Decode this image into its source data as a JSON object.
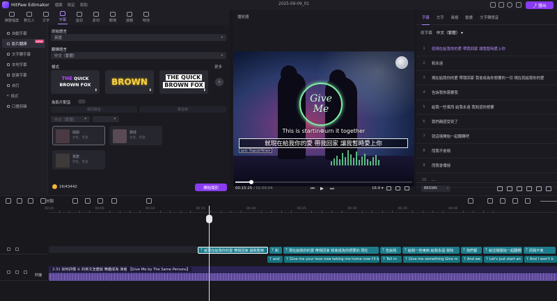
{
  "app": {
    "name": "HitPaw Edimakor",
    "menus": [
      "檔案",
      "設定",
      "幫助"
    ],
    "document_title": "2025-09-09_01",
    "export_label": "匯出"
  },
  "toolbar": {
    "items": [
      {
        "label": "媒體檔案"
      },
      {
        "label": "數位人"
      },
      {
        "label": "文字"
      },
      {
        "label": "字幕"
      },
      {
        "label": "音訊"
      },
      {
        "label": "素材"
      },
      {
        "label": "轉場"
      },
      {
        "label": "濾鏡"
      },
      {
        "label": "特效"
      }
    ],
    "active_index": 3
  },
  "sidebar": {
    "items": [
      {
        "label": "自動字幕"
      },
      {
        "label": "影片翻譯",
        "badge": "NEW"
      },
      {
        "label": "文字轉字幕"
      },
      {
        "label": "本地字幕"
      },
      {
        "label": "創建字幕"
      },
      {
        "label": "自訂"
      },
      {
        "label": "樣式"
      },
      {
        "label": "口播剪輯"
      }
    ],
    "active_index": 1
  },
  "settings": {
    "source_lang_label": "原始語言",
    "source_lang_value": "英語",
    "target_lang_label": "翻譯語言",
    "target_lang_value": "中文（繁體）",
    "style_label": "樣式",
    "more_label": "更多",
    "style_samples": [
      {
        "line1": "THE",
        "line1b": "QUICK",
        "line2": "BROWN FOX"
      },
      {
        "line1": "BROWN"
      },
      {
        "line1": "THE QUICK",
        "line2": "BROWN FOX"
      }
    ],
    "dub_label": "為影片配音",
    "voice_filter_1": "相同聲音",
    "voice_filter_2": "聲音庫",
    "lang_select": "中文（繁體）",
    "voices": [
      {
        "name": "娟娟",
        "tag": "女性，普通"
      },
      {
        "name": "蔣娃",
        "tag": "女性，普通"
      },
      {
        "name": "賈群",
        "tag": "男性，普通"
      }
    ],
    "credits_value": "16/43442",
    "start_button": "開始識別"
  },
  "player": {
    "title": "播放器",
    "overlay_text": "This is startin⊕urn it together",
    "givme_1": "Give",
    "givme_2": "Me",
    "subtitle_text": "就現在給我你的愛 帶我回家 讓我暫時愛上你",
    "credit_text": "Lyric: Tropical Phrase",
    "time_current": "00:15:25",
    "time_total": "/ 02:56:04",
    "ratio": "16:9",
    "progress_fraction": 0.09
  },
  "right_panel": {
    "tabs": [
      "字幕",
      "文字",
      "風格",
      "動畫",
      "文字轉語音"
    ],
    "active_tab": 0,
    "source_label": "原字幕",
    "lang_value": "中文（繁體）",
    "rows": [
      {
        "n": "1",
        "text": "就現在給我你的愛 帶我回家 讓我暫時愛上你"
      },
      {
        "n": "2",
        "text": "和永遠"
      },
      {
        "n": "3",
        "text": "現在給我你的愛 帶我回家 我會成為你想要的一切 現在就給我你的愛"
      },
      {
        "n": "4",
        "text": "告訴我你需要我"
      },
      {
        "n": "5",
        "text": "給我一些東西 給我永遠 我知道你想要"
      },
      {
        "n": "6",
        "text": "我們都感受到了"
      },
      {
        "n": "7",
        "text": "就這樣開始一起翻轉吧"
      },
      {
        "n": "8",
        "text": "而我不會傾"
      },
      {
        "n": "9",
        "text": "而我會傳授"
      },
      {
        "n": "10",
        "text": "…"
      }
    ],
    "active_row": 0,
    "font_select": "BROWN"
  },
  "timeline": {
    "split_label": "分割",
    "ruler": [
      "00:00",
      "00:05",
      "00:10",
      "00:15",
      "00:20",
      "00:25",
      "00:30",
      "00:35",
      "00:40"
    ],
    "cover_label": "封面",
    "video_clip_label": "2:31 如何評價 ① 的英文怎麼說 樂趣成為 演者 【Give Me by The Same Persons】",
    "subs_row1": [
      "就現在給我你的愛 帶我回家 讓我暫時",
      "和",
      "現在給我你的愛 帶我回家 我會成為你想要的 現在",
      "告訴我",
      "給我一些東西 給我永遠 我知",
      "我們都",
      "就這樣開始一起翻轉",
      "而我不會"
    ],
    "subs_row2": [
      "and",
      "Give me your love now taking me home now I'll b",
      "Tell m",
      "Give me something Give m",
      "And we",
      "Let's just start an",
      "And I won't b"
    ]
  }
}
